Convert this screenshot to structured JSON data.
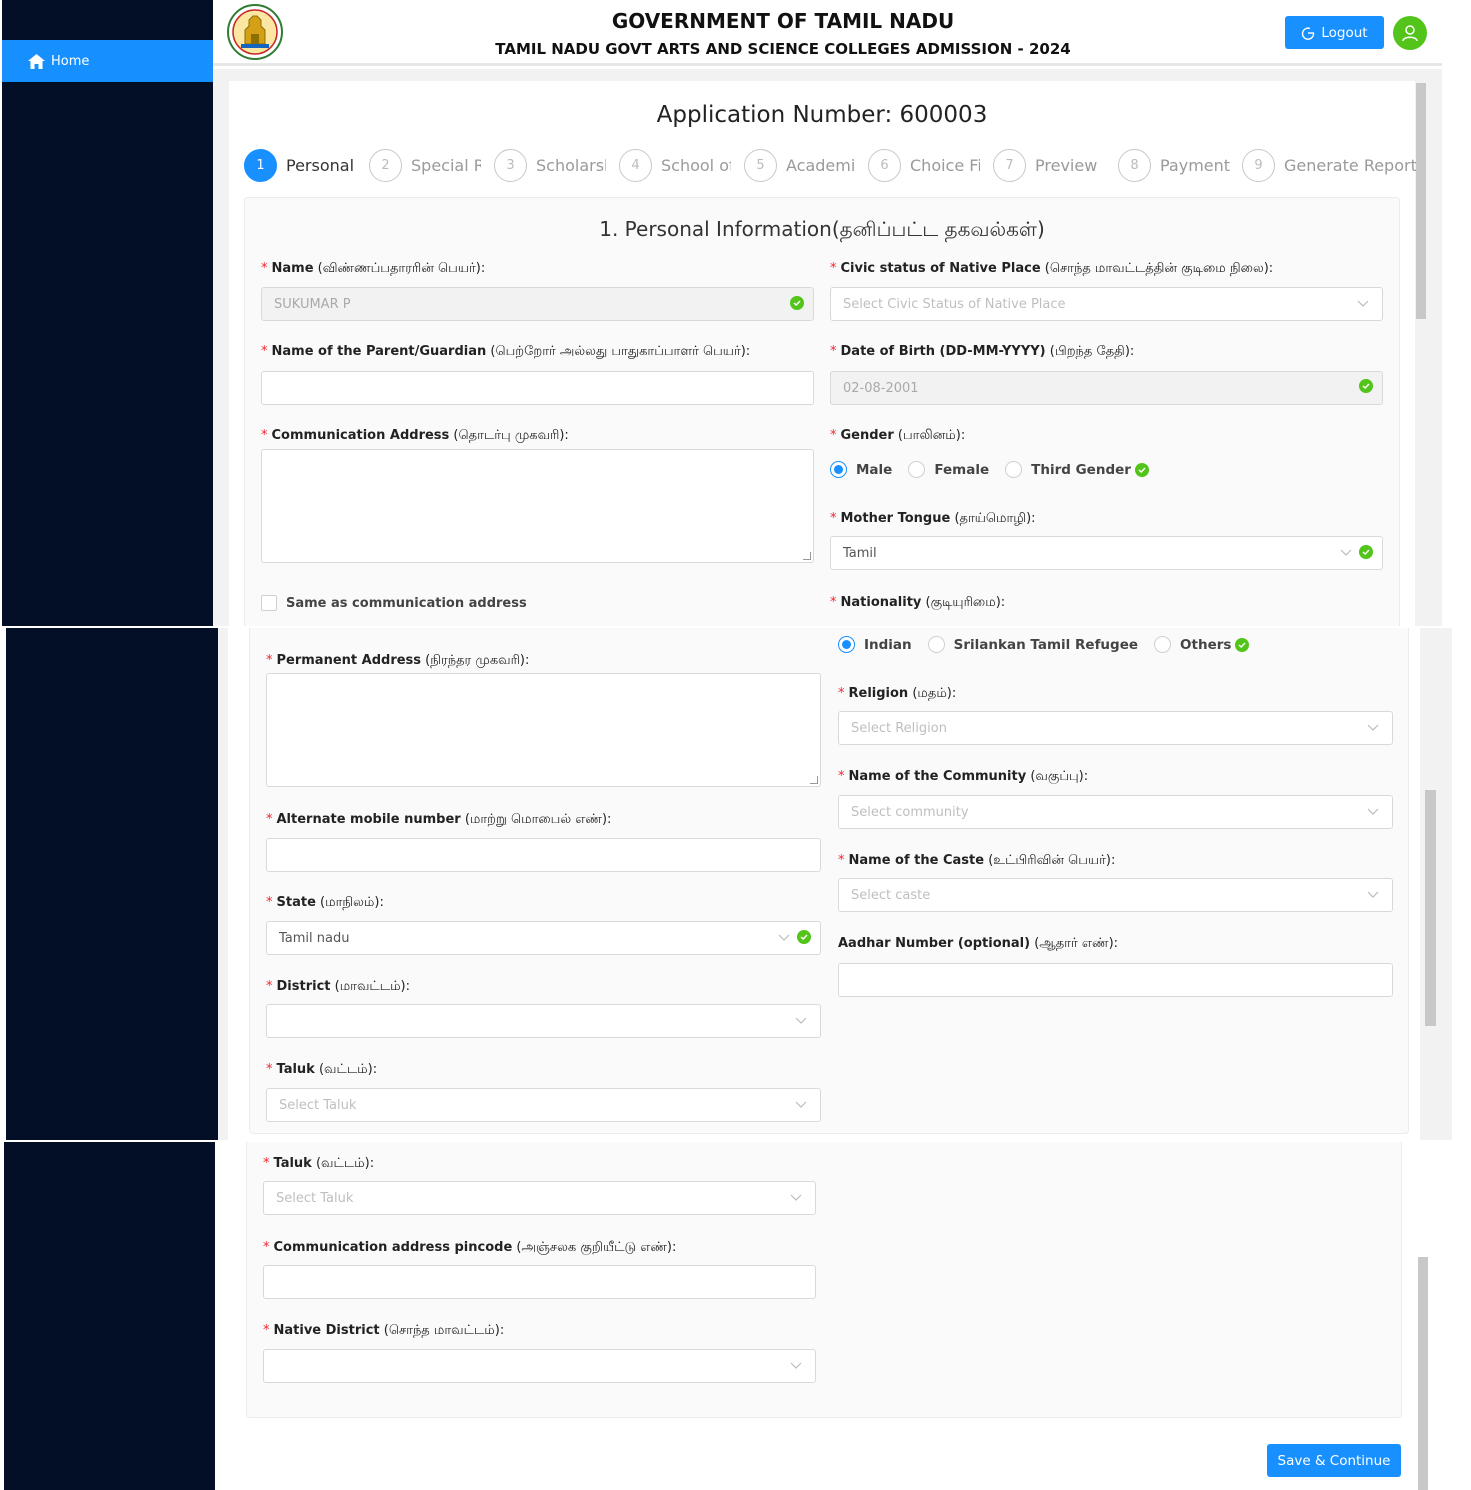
{
  "sidebar": {
    "home_label": "Home"
  },
  "header": {
    "title": "GOVERNMENT OF TAMIL NADU",
    "subtitle": "TAMIL NADU GOVT ARTS AND SCIENCE COLLEGES ADMISSION - 2024",
    "logout_label": "Logout"
  },
  "application_number": "Application Number: 600003",
  "steps": [
    {
      "num": "1",
      "label": "Personal"
    },
    {
      "num": "2",
      "label": "Special Re"
    },
    {
      "num": "3",
      "label": "Scholarsh"
    },
    {
      "num": "4",
      "label": "School of"
    },
    {
      "num": "5",
      "label": "Academic"
    },
    {
      "num": "6",
      "label": "Choice Fil"
    },
    {
      "num": "7",
      "label": "Preview"
    },
    {
      "num": "8",
      "label": "Payment"
    },
    {
      "num": "9",
      "label": "Generate Report"
    }
  ],
  "form": {
    "title": "1. Personal Information(தனிப்பட்ட தகவல்கள்)",
    "name": {
      "label": "Name",
      "tamil": "(விண்ணப்பதாரரின் பெயர்):",
      "value": "SUKUMAR P"
    },
    "civic": {
      "label": "Civic status of Native Place",
      "tamil": "(சொந்த மாவட்டத்தின் குடிமை நிலை):",
      "placeholder": "Select Civic Status of Native Place"
    },
    "parent": {
      "label": "Name of the Parent/Guardian",
      "tamil": "(பெற்றோர் அல்லது பாதுகாப்பாளர் பெயர்):"
    },
    "dob": {
      "label": "Date of Birth (DD-MM-YYYY)",
      "tamil": "(பிறந்த தேதி):",
      "value": "02-08-2001"
    },
    "comm_address": {
      "label": "Communication Address",
      "tamil": "(தொடர்பு முகவரி):"
    },
    "gender": {
      "label": "Gender",
      "tamil": "(பாலினம்):",
      "options": [
        "Male",
        "Female",
        "Third Gender"
      ]
    },
    "mother_tongue": {
      "label": "Mother Tongue",
      "tamil": "(தாய்மொழி):",
      "value": "Tamil"
    },
    "same_as": "Same as communication address",
    "nationality": {
      "label": "Nationality",
      "tamil": "(குடியுரிமை):",
      "options": [
        "Indian",
        "Srilankan Tamil Refugee",
        "Others"
      ]
    },
    "perm_address": {
      "label": "Permanent Address",
      "tamil": "(நிரந்தர முகவரி):"
    },
    "religion": {
      "label": "Religion",
      "tamil": "(மதம்):",
      "placeholder": "Select Religion"
    },
    "community": {
      "label": "Name of the Community",
      "tamil": "(வகுப்பு):",
      "placeholder": "Select community"
    },
    "alt_mobile": {
      "label": "Alternate mobile number",
      "tamil": "(மாற்று மொபைல் எண்):"
    },
    "caste": {
      "label": "Name of the Caste",
      "tamil": "(உட்பிரிவின் பெயர்):",
      "placeholder": "Select caste"
    },
    "state": {
      "label": "State",
      "tamil": "(மாநிலம்):",
      "value": "Tamil nadu"
    },
    "aadhar": {
      "label": "Aadhar Number (optional)",
      "tamil": "(ஆதார் எண்):"
    },
    "district": {
      "label": "District",
      "tamil": "(மாவட்டம்):"
    },
    "taluk": {
      "label": "Taluk",
      "tamil": "(வட்டம்):",
      "placeholder": "Select Taluk"
    },
    "pincode": {
      "label": "Communication address pincode",
      "tamil": "(அஞ்சலக குறியீட்டு எண்):"
    },
    "native_district": {
      "label": "Native District",
      "tamil": "(சொந்த மாவட்டம்):"
    }
  },
  "save_label": "Save & Continue",
  "colors": {
    "primary": "#1890ff",
    "sidebar": "#020f26",
    "success": "#52c41a",
    "required": "#f5222d"
  }
}
